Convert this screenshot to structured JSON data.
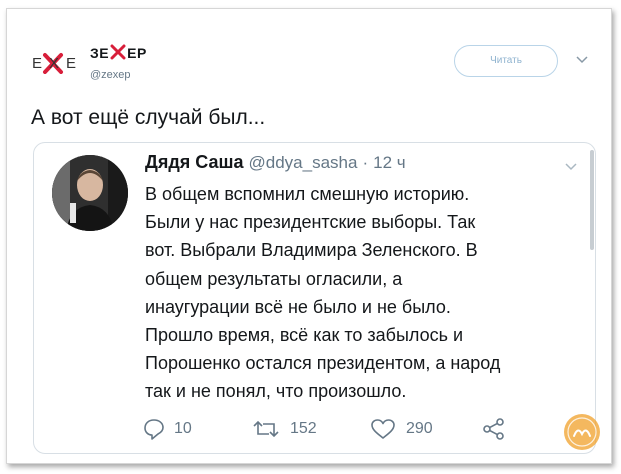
{
  "author": {
    "logo_text": "EXE",
    "name_parts": [
      "ЗЕ",
      "ЕР"
    ],
    "handle": "@zexep"
  },
  "follow_button": {
    "label": "Читать"
  },
  "tweet": {
    "text": "А вот ещё случай был..."
  },
  "quoted": {
    "name": "Дядя Саша",
    "handle": "@ddya_sasha",
    "separator": "·",
    "time": "12 ч",
    "lines": [
      "В общем вспомнил смешную историю.",
      "Были у нас президентские выборы. Так",
      "вот. Выбрали Владимира Зеленского. В",
      "общем результаты огласили, а",
      "инаугурации всё не было и не было.",
      "Прошло время, всё как то забылось и",
      "Порошенко остался президентом, а народ",
      "так и не понял, что произошло."
    ],
    "actions": {
      "replies": "10",
      "retweets": "152",
      "likes": "290"
    }
  },
  "colors": {
    "accent_x": "#d81e3a",
    "muted": "#657786",
    "follow_border": "#b9d4e8",
    "watermark": "#f0a02a"
  },
  "icons": [
    "reply-icon",
    "retweet-icon",
    "like-icon",
    "share-icon",
    "chevron-down-icon"
  ]
}
